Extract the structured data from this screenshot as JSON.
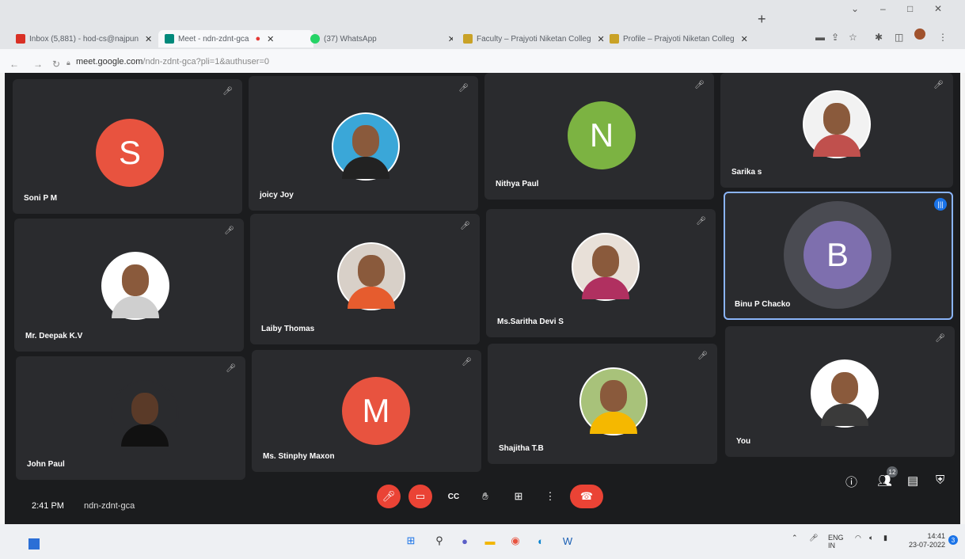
{
  "browser": {
    "tabs": [
      {
        "label": "Inbox (5,881) - hod-cs@najpun",
        "color": "#d93025"
      },
      {
        "label": "Meet - ndn-zdnt-gca",
        "color": "#00897b"
      },
      {
        "label": "(37) WhatsApp",
        "color": "#25d366"
      },
      {
        "label": "Faculty – Prajyoti Niketan Colleg",
        "color": "#c9a227"
      },
      {
        "label": "Profile – Prajyoti Niketan Colleg",
        "color": "#c9a227"
      }
    ],
    "new_tab": "+",
    "url_main": "meet.google.com",
    "url_rest": "/ndn-zdnt-gca?pli=1&authuser=0",
    "window_controls": {
      "minimize": "–",
      "maximize": "□",
      "close": "✕"
    }
  },
  "participants": [
    {
      "name": "Soni P M",
      "initial": "S",
      "color": "#e8533f",
      "type": "letter"
    },
    {
      "name": "joicy Joy",
      "type": "photo",
      "bg": "#3aa7d8"
    },
    {
      "name": "Nithya Paul",
      "initial": "N",
      "color": "#7cb342",
      "type": "letter"
    },
    {
      "name": "Sarika s",
      "type": "photo",
      "bg": "#f2f2f2"
    },
    {
      "name": "Mr. Deepak K.V",
      "type": "photo",
      "bg": "#ffffff"
    },
    {
      "name": "Laiby Thomas",
      "type": "photo",
      "bg": "#d8d0c8"
    },
    {
      "name": "Ms.Saritha Devi S",
      "type": "photo",
      "bg": "#e8e0d8"
    },
    {
      "name": "Binu P Chacko",
      "initial": "B",
      "color": "#7e6fae",
      "type": "letter",
      "speaking": true
    },
    {
      "name": "John Paul",
      "type": "photo",
      "bg": "#2a2b2e"
    },
    {
      "name": "Ms. Stinphy Maxon",
      "initial": "M",
      "color": "#e8533f",
      "type": "letter"
    },
    {
      "name": "Shajitha T.B",
      "type": "photo",
      "bg": "#a8c27a"
    },
    {
      "name": "You",
      "type": "photo",
      "bg": "#ffffff"
    }
  ],
  "meeting": {
    "time": "2:41 PM",
    "code": "ndn-zdnt-gca",
    "people_count": "12"
  },
  "taskbar": {
    "lang": "ENG",
    "region": "IN",
    "time": "14:41",
    "date": "23-07-2022",
    "notifications": "3"
  },
  "colors": {
    "accent": "#8ab4f8",
    "end_call": "#ea4335"
  }
}
